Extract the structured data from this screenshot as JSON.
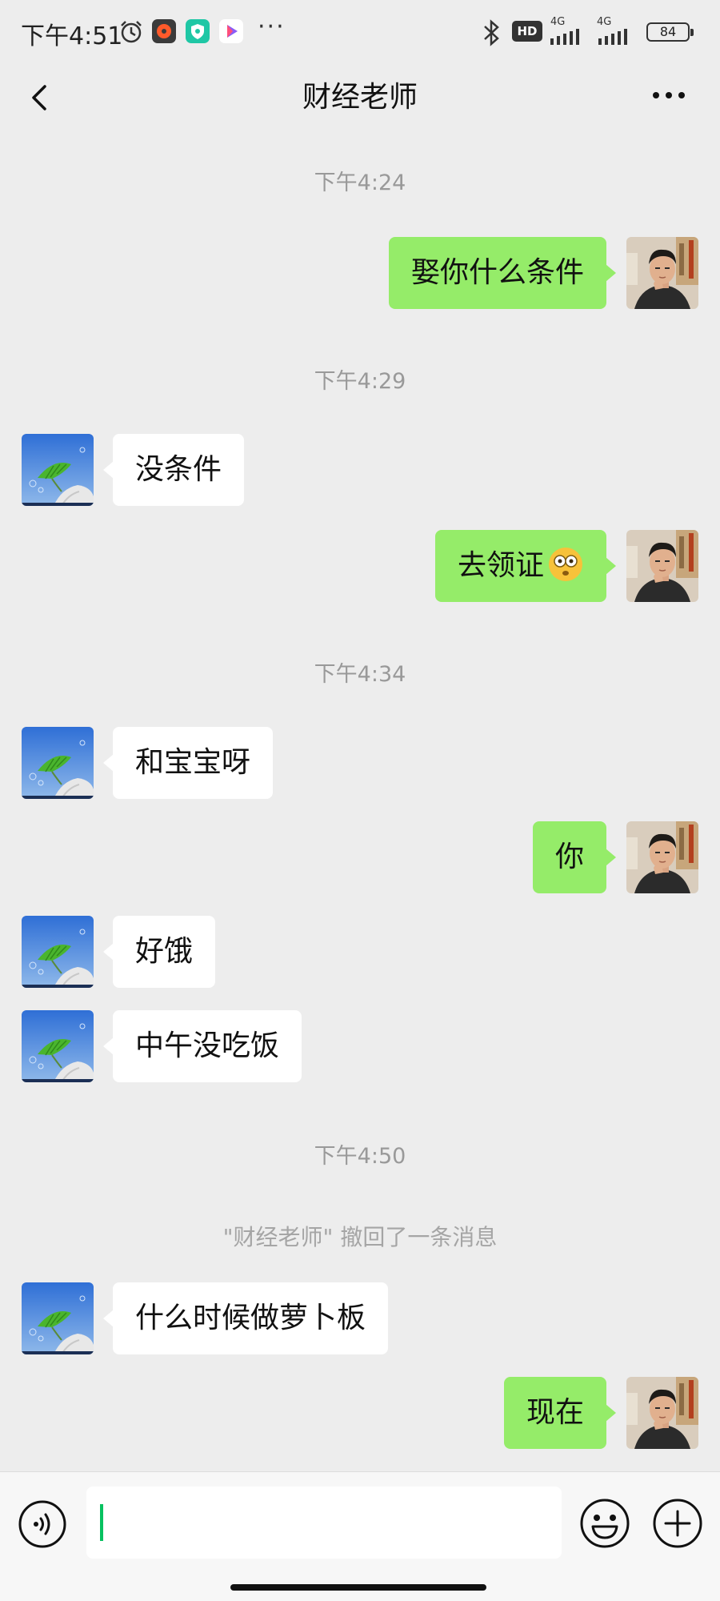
{
  "status_bar": {
    "time": "下午4:51",
    "hd_label": "HD",
    "network_1": "4G",
    "network_2": "4G",
    "battery": "84",
    "icons": [
      "alarm-icon",
      "music-app-icon",
      "security-app-icon",
      "video-app-icon",
      "bluetooth-icon",
      "signal-icon",
      "signal-icon"
    ]
  },
  "header": {
    "title": "财经老师"
  },
  "colors": {
    "background": "#ededed",
    "self_bubble": "#95ec69",
    "other_bubble": "#ffffff",
    "caret": "#07c160"
  },
  "messages": [
    {
      "type": "time",
      "text": "下午4:24"
    },
    {
      "type": "self",
      "text": "娶你什么条件"
    },
    {
      "type": "time",
      "text": "下午4:29"
    },
    {
      "type": "other",
      "text": "没条件"
    },
    {
      "type": "self",
      "text": "去领证",
      "emoji": "flushed-face"
    },
    {
      "type": "time",
      "text": "下午4:34"
    },
    {
      "type": "other",
      "text": "和宝宝呀"
    },
    {
      "type": "self",
      "text": "你"
    },
    {
      "type": "other",
      "text": "好饿"
    },
    {
      "type": "other",
      "text": "中午没吃饭"
    },
    {
      "type": "time",
      "text": "下午4:50"
    },
    {
      "type": "system",
      "text": "\"财经老师\" 撤回了一条消息"
    },
    {
      "type": "other",
      "text": "什么时候做萝卜板"
    },
    {
      "type": "self",
      "text": "现在"
    }
  ],
  "input": {
    "value": "",
    "placeholder": ""
  }
}
